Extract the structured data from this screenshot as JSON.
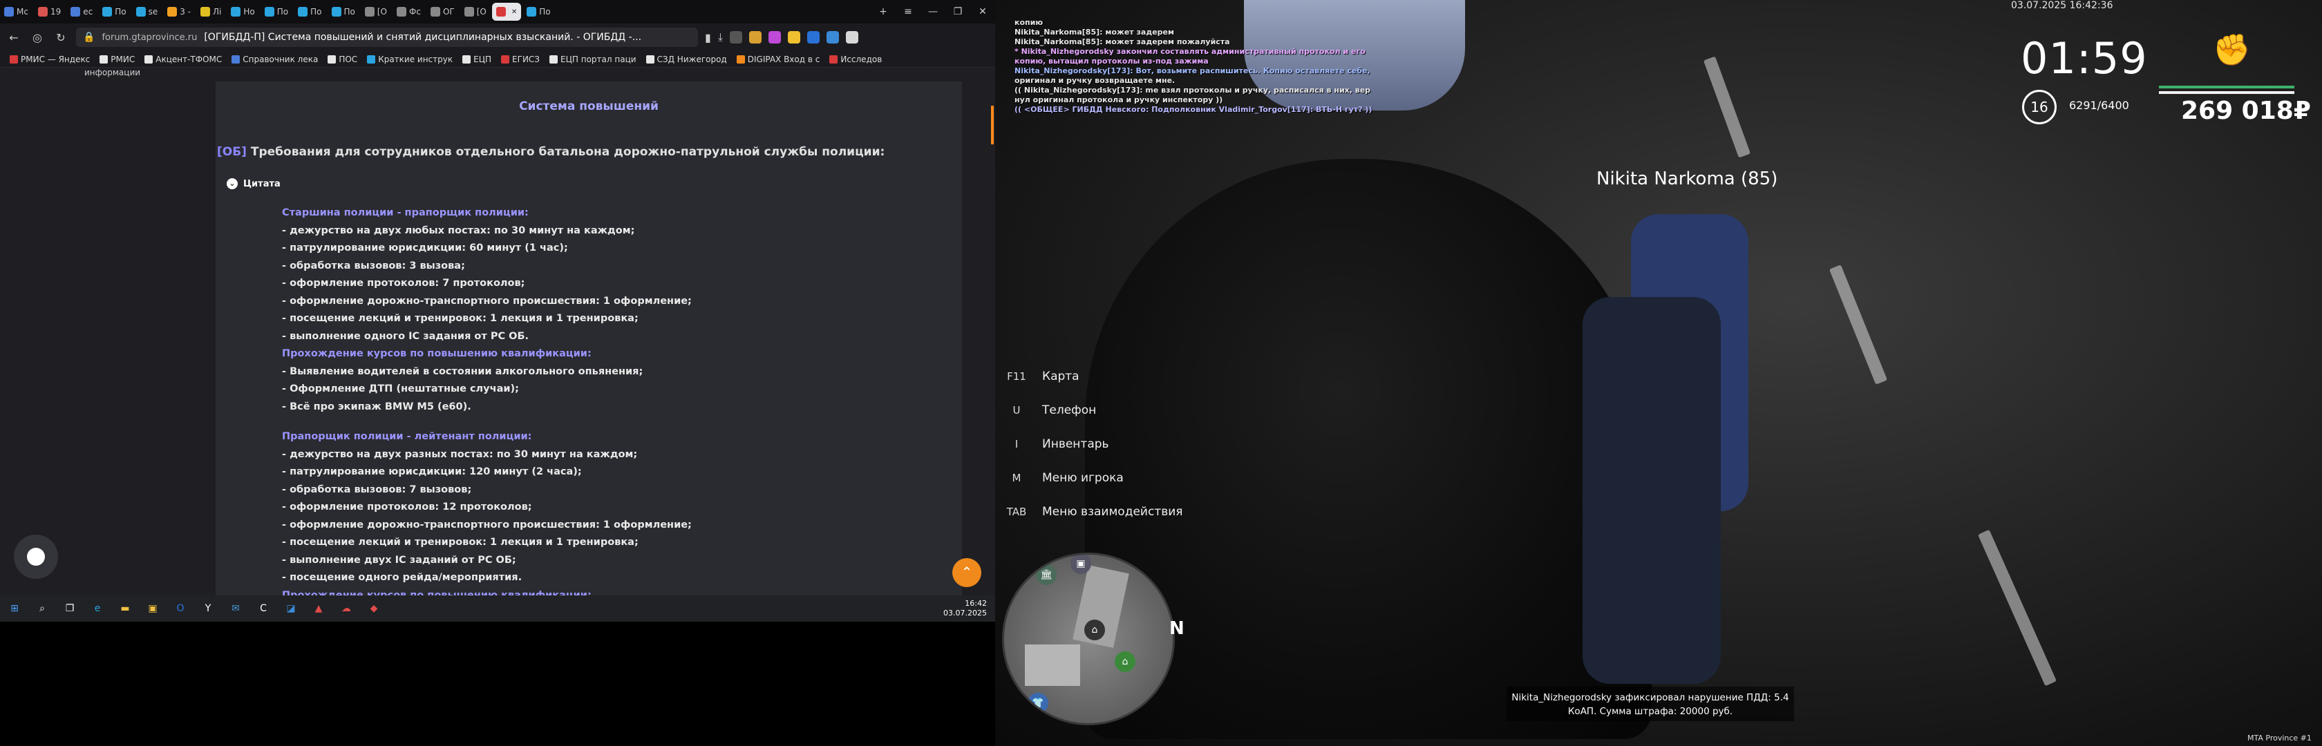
{
  "browser": {
    "tabs": [
      {
        "label": "Мс",
        "color": "#4a7bd8"
      },
      {
        "label": "19",
        "color": "#d9534f"
      },
      {
        "label": "ес",
        "color": "#4a7bd8"
      },
      {
        "label": "По",
        "color": "#2ba5e0"
      },
      {
        "label": "se",
        "color": "#2ba5e0"
      },
      {
        "label": "3 -",
        "color": "#f0a020"
      },
      {
        "label": "Лі",
        "color": "#e0c020"
      },
      {
        "label": "Но",
        "color": "#2ba5e0"
      },
      {
        "label": "По",
        "color": "#2ba5e0"
      },
      {
        "label": "По",
        "color": "#2ba5e0"
      },
      {
        "label": "По",
        "color": "#2ba5e0"
      },
      {
        "label": "[О",
        "color": "#888888"
      },
      {
        "label": "Фс",
        "color": "#888888"
      },
      {
        "label": "ОГ",
        "color": "#888888"
      },
      {
        "label": "[О",
        "color": "#888888"
      },
      {
        "label": "",
        "color": "#d83a3a",
        "active": true
      },
      {
        "label": "По",
        "color": "#2ba5e0"
      }
    ],
    "new_tab_label": "+",
    "window_controls": [
      "≡",
      "—",
      "❐",
      "✕"
    ],
    "nav": {
      "back": "←",
      "reload": "↻"
    },
    "url_domain": "forum.gtaprovince.ru",
    "url_title": "[ОГИБДД-П] Система повышений и снятий дисциплинарных взысканий. - ОГИБДД -...",
    "bookmarks": [
      {
        "label": "РМИС — Яндекс",
        "color": "#d83a3a"
      },
      {
        "label": "РМИС",
        "color": "#e6e6e6"
      },
      {
        "label": "Акцент-ТФОМС",
        "color": "#e6e6e6"
      },
      {
        "label": "Справочник лека",
        "color": "#4a7bd8"
      },
      {
        "label": "ПОС",
        "color": "#e6e6e6"
      },
      {
        "label": "Краткие инструк",
        "color": "#2ba5e0"
      },
      {
        "label": "ЕЦП",
        "color": "#e6e6e6"
      },
      {
        "label": "ЕГИСЗ",
        "color": "#d83a3a"
      },
      {
        "label": "ЕЦП портал паци",
        "color": "#e6e6e6"
      },
      {
        "label": "СЗД Нижегород",
        "color": "#e6e6e6"
      },
      {
        "label": "DIGIPAX Вход в с",
        "color": "#f08a1c"
      },
      {
        "label": "Исследов",
        "color": "#d83a3a"
      }
    ]
  },
  "page": {
    "breadcrumb": "информации",
    "section_title": "Система повышений",
    "subhead_tag": "[ОБ]",
    "subhead_text": "Требования для сотрудников отдельного батальона дорожно-патрульной службы полиции:",
    "quote_label": "Цитата",
    "quote_lines": [
      {
        "text": "Старшина полиции - прапорщик полиции:",
        "h": true
      },
      {
        "text": "- дежурство на двух любых постах: по 30 минут на каждом;"
      },
      {
        "text": "- патрулирование юрисдикции: 60 минут (1 час);"
      },
      {
        "text": "- обработка вызовов: 3 вызова;"
      },
      {
        "text": "- оформление протоколов: 7 протоколов;"
      },
      {
        "text": "- оформление дорожно-транспортного происшествия: 1 оформление;"
      },
      {
        "text": "- посещение лекций и тренировок: 1 лекция и 1 тренировка;"
      },
      {
        "text": "- выполнение одного IC задания от РС ОБ."
      },
      {
        "text": "Прохождение курсов по повышению квалификации:",
        "h": true
      },
      {
        "text": "- Выявление водителей в состоянии алкогольного опьянения;"
      },
      {
        "text": "- Оформление ДТП (нештатные случаи);"
      },
      {
        "text": "- Всё про экипаж BMW M5 (e60)."
      },
      {
        "text": "",
        "gap": true
      },
      {
        "text": "Прапорщик полиции - лейтенант полиции:",
        "h": true
      },
      {
        "text": "- дежурство на двух разных постах: по 30 минут на каждом;"
      },
      {
        "text": "- патрулирование юрисдикции: 120 минут (2 часа);"
      },
      {
        "text": "- обработка вызовов: 7 вызовов;"
      },
      {
        "text": "- оформление протоколов: 12 протоколов;"
      },
      {
        "text": "- оформление дорожно-транспортного происшествия: 1 оформление;"
      },
      {
        "text": "- посещение лекций и тренировок: 1 лекция и 1 тренировка;"
      },
      {
        "text": "- выполнение двух IC заданий от РС ОБ;"
      },
      {
        "text": "- посещение одного рейда/мероприятия."
      },
      {
        "text": "Прохождение курсов по повышению квалификации:",
        "h": true
      }
    ],
    "top_fab": "⌃"
  },
  "taskbar": {
    "icons": [
      {
        "name": "start",
        "glyph": "⊞",
        "color": "#4aa3ff"
      },
      {
        "name": "search",
        "glyph": "⌕",
        "color": "#ffffff"
      },
      {
        "name": "task-view",
        "glyph": "❐",
        "color": "#ffffff"
      },
      {
        "name": "edge",
        "glyph": "e",
        "color": "#2aa0d8"
      },
      {
        "name": "explorer",
        "glyph": "▬",
        "color": "#f0c040"
      },
      {
        "name": "store",
        "glyph": "▣",
        "color": "#f0c040"
      },
      {
        "name": "outlook",
        "glyph": "O",
        "color": "#2a72d8"
      },
      {
        "name": "yandex",
        "glyph": "Y",
        "color": "#ffffff"
      },
      {
        "name": "mail",
        "glyph": "✉",
        "color": "#4a9ad8"
      },
      {
        "name": "app-c",
        "glyph": "C",
        "color": "#ffffff"
      },
      {
        "name": "app-blue",
        "glyph": "◪",
        "color": "#3a8ad8"
      },
      {
        "name": "app-red",
        "glyph": "▲",
        "color": "#e04a4a"
      },
      {
        "name": "app-cloud",
        "glyph": "☁",
        "color": "#e04a4a"
      },
      {
        "name": "app-red2",
        "glyph": "◆",
        "color": "#e04a4a"
      }
    ],
    "time": "16:42",
    "date": "03.07.2025"
  },
  "game": {
    "chat": [
      {
        "text": "копию",
        "style": "w"
      },
      {
        "text": "Nikita_Narkoma[85]: может задерем",
        "style": "w"
      },
      {
        "text": "Nikita_Narkoma[85]: может задерем пожалуйста",
        "style": "w"
      },
      {
        "text": "* Nikita_Nizhegorodsky закончил составлять административный протокол и его",
        "style": "pink"
      },
      {
        "text": "копию, вытащил протоколы из-под зажима",
        "style": "pink"
      },
      {
        "text": "Nikita_Nizhegorodsky[173]: Вот, возьмите распишитесь. Копию оставляете себе,",
        "style": "blue"
      },
      {
        "text": "оригинал и ручку возвращаете мне.",
        "style": "w"
      },
      {
        "text": "(( Nikita_Nizhegorodsky[173]: me взял протоколы и ручку, расписался в них, вер",
        "style": "w"
      },
      {
        "text": "нул оригинал протокола и ручку инспектору ))",
        "style": "w"
      },
      {
        "text": "(( <ОБЩЕЕ> ГИБДД Невского: Подполковник Vladimir_Torgov[117]: ВТЬ-Н гут? ))",
        "style": "ooc"
      }
    ],
    "datetime": "03.07.2025 16:42:36",
    "clock": "01:59",
    "level": "16",
    "xp": "6291/6400",
    "money": "269 018₽",
    "nametag": "Nikita Narkoma (85)",
    "menu": [
      {
        "key": "F11",
        "label": "Карта"
      },
      {
        "key": "U",
        "label": "Телефон"
      },
      {
        "key": "I",
        "label": "Инвентарь"
      },
      {
        "key": "M",
        "label": "Меню игрока"
      },
      {
        "key": "TAB",
        "label": "Меню взаимодействия"
      }
    ],
    "compass": "N",
    "notice_line1": "Nikita_Nizhegorodsky зафиксировал нарушение ПДД: 5.4",
    "notice_line2": "КоАП. Сумма штрафа: 20000 руб.",
    "watermark": "MTA Province #1"
  }
}
